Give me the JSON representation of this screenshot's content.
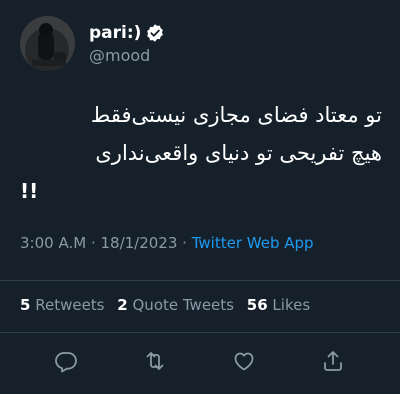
{
  "author": {
    "display_name": "pari:)",
    "handle": "@mood",
    "verified": true,
    "avatar": "profile-photo"
  },
  "tweet": {
    "lines": [
      "تو معتاد فضای مجازی نیستی‌فقط",
      "هیچ تفریحی تو دنیای واقعی‌نداری",
      "!!"
    ]
  },
  "meta": {
    "time": "3:00 A.M",
    "separator": " · ",
    "date": "18/1/2023",
    "source": "Twitter Web App"
  },
  "stats": {
    "retweets_count": "5",
    "retweets_label": "Retweets",
    "quotes_count": "2",
    "quotes_label": "Quote Tweets",
    "likes_count": "56",
    "likes_label": "Likes"
  },
  "actions": [
    {
      "name": "reply",
      "icon": "reply-icon"
    },
    {
      "name": "retweet",
      "icon": "retweet-icon"
    },
    {
      "name": "like",
      "icon": "like-icon"
    },
    {
      "name": "share",
      "icon": "share-icon"
    }
  ],
  "colors": {
    "background": "#15202b",
    "text_primary": "#ffffff",
    "text_secondary": "#8b98a5",
    "accent": "#1d9bf0",
    "divider": "#2f3b47"
  }
}
